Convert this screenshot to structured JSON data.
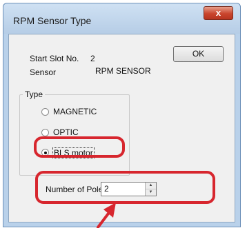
{
  "window": {
    "title": "RPM Sensor Type",
    "close_label": "x"
  },
  "ok_button": {
    "label": "OK"
  },
  "info": {
    "start_slot_label": "Start Slot No.",
    "start_slot_value": "2",
    "sensor_label": "Sensor",
    "sensor_value": "RPM SENSOR"
  },
  "type_group": {
    "title": "Type",
    "options": [
      {
        "label": "MAGNETIC",
        "checked": false
      },
      {
        "label": "OPTIC",
        "checked": false
      },
      {
        "label": "BLS motor",
        "checked": true
      }
    ]
  },
  "pole": {
    "label": "Number of Pole",
    "value": "2"
  },
  "annotation": {
    "highlight_color": "#d7262e"
  }
}
